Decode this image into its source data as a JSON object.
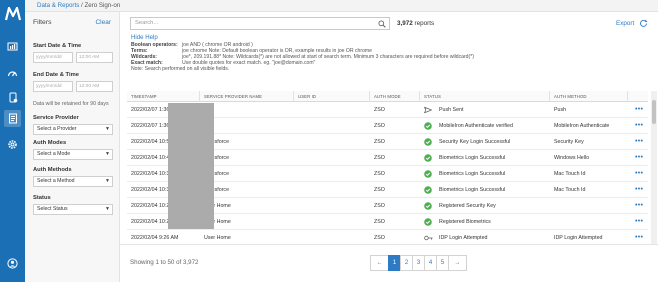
{
  "breadcrumb": {
    "parent": "Data & Reports",
    "separator": " / ",
    "current": "Zero Sign-on"
  },
  "filters": {
    "title": "Filters",
    "clear_label": "Clear",
    "start_label": "Start Date & Time",
    "end_label": "End Date & Time",
    "date_placeholder": "yyyy/mm/dd",
    "time_placeholder": "12:00 AM",
    "retention_note": "Data will be retained for 90 days",
    "service_provider_label": "Service Provider",
    "service_provider_value": "Select a Provider",
    "auth_modes_label": "Auth Modes",
    "auth_modes_value": "Select a Mode",
    "auth_methods_label": "Auth Methods",
    "auth_methods_value": "Select a Method",
    "status_label": "Status",
    "status_value": "Select Status"
  },
  "search": {
    "placeholder": "Search..."
  },
  "report_count": {
    "number": "3,972",
    "suffix": "reports"
  },
  "export_label": "Export",
  "help": {
    "hide_label": "Hide Help",
    "lines": [
      {
        "key": "Boolean operators:",
        "value": "joe AND ( chrome OR android )"
      },
      {
        "key": "Terms:",
        "value": "joe chrome Note: Default boolean operator is OR, example results in joe OR chrome"
      },
      {
        "key": "Wildcards:",
        "value": "joe*, 209.191.88* Note: Wildcards(*) are not allowed at start of search term. Minimum 3 characters are required before wildcard(*)"
      },
      {
        "key": "Exact match:",
        "value": "Use double quotes for exact match. eg. \"joe@domain.com\""
      },
      {
        "key": "Note: Search performed on all visible fields.",
        "value": ""
      }
    ]
  },
  "table": {
    "columns": [
      "TIMESTAMP",
      "SERVICE PROVIDER NAME",
      "USER ID",
      "AUTH MODE",
      "STATUS",
      "AUTH METHOD"
    ],
    "rows": [
      {
        "timestamp": "2022/02/07 1:36 PM",
        "provider": "",
        "mode": "ZSO",
        "status": "Push Sent",
        "status_type": "push",
        "method": "Push"
      },
      {
        "timestamp": "2022/02/07 1:36 PM",
        "provider": "",
        "mode": "ZSO",
        "status": "MobileIron Authenticate verified",
        "status_type": "ok",
        "method": "MobileIron Authenticate"
      },
      {
        "timestamp": "2022/02/04 10:58 AM",
        "provider": "Salesforce",
        "mode": "ZSO",
        "status": "Security Key Login Successful",
        "status_type": "ok",
        "method": "Security Key"
      },
      {
        "timestamp": "2022/02/04 10:44 AM",
        "provider": "Salesforce",
        "mode": "ZSO",
        "status": "Biometrics Login Successful",
        "status_type": "ok",
        "method": "Windows Hello"
      },
      {
        "timestamp": "2022/02/04 10:39 AM",
        "provider": "Salesforce",
        "mode": "ZSO",
        "status": "Biometrics Login Successful",
        "status_type": "ok",
        "method": "Mac Touch Id"
      },
      {
        "timestamp": "2022/02/04 10:37 AM",
        "provider": "Salesforce",
        "mode": "ZSO",
        "status": "Biometrics Login Successful",
        "status_type": "ok",
        "method": "Mac Touch Id"
      },
      {
        "timestamp": "2022/02/04 10:27 AM",
        "provider": "User Home",
        "mode": "ZSO",
        "status": "Registered Security Key",
        "status_type": "ok",
        "method": ""
      },
      {
        "timestamp": "2022/02/04 10:22 AM",
        "provider": "User Home",
        "mode": "ZSO",
        "status": "Registered Biometrics",
        "status_type": "ok",
        "method": ""
      },
      {
        "timestamp": "2022/02/04 9:26 AM",
        "provider": "User Home",
        "mode": "ZSO",
        "status": "IDP Login Attempted",
        "status_type": "key",
        "method": "IDP Login Attempted"
      }
    ],
    "actions_glyph": "•••"
  },
  "footer": {
    "showing": "Showing 1 to 50 of 3,972",
    "pages": [
      "←",
      "1",
      "2",
      "3",
      "4",
      "5",
      "→"
    ],
    "active_page": "1"
  },
  "colors": {
    "rail": "#1b6fb5",
    "link": "#2d7bc4",
    "success": "#4caf50",
    "redaction": "#ababab"
  },
  "icons": {
    "rail": [
      "logo-icon",
      "dashboard-icon",
      "gauge-icon",
      "device-icon",
      "reports-icon",
      "settings-icon",
      "user-icon"
    ],
    "search": "search-icon",
    "export": "refresh-icon"
  }
}
